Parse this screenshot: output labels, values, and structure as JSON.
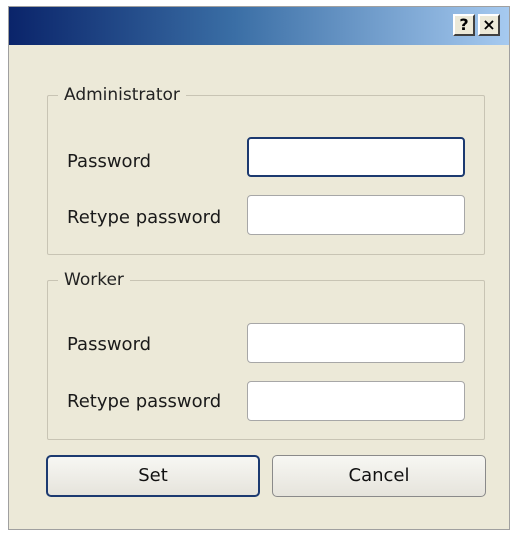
{
  "titlebar": {
    "help_label": "?",
    "close_label": "×"
  },
  "administrator": {
    "legend": "Administrator",
    "password_label": "Password",
    "password_value": "",
    "retype_label": "Retype password",
    "retype_value": ""
  },
  "worker": {
    "legend": "Worker",
    "password_label": "Password",
    "password_value": "",
    "retype_label": "Retype password",
    "retype_value": ""
  },
  "buttons": {
    "set_label": "Set",
    "cancel_label": "Cancel"
  }
}
